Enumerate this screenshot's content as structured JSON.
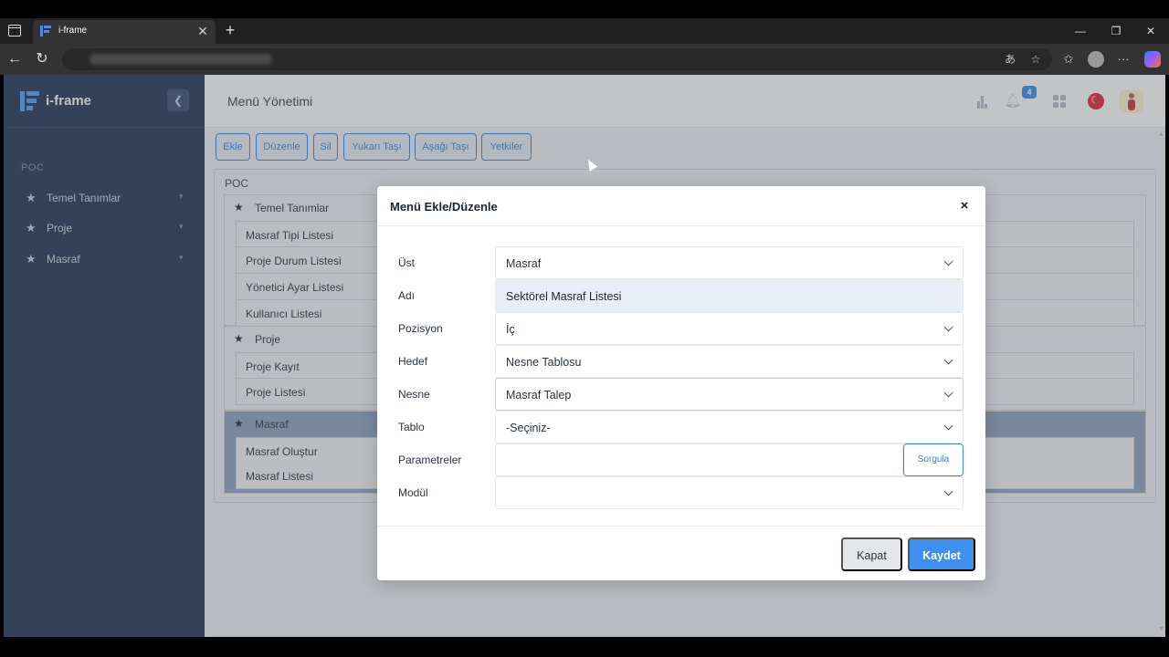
{
  "browser": {
    "tab_title": "i-frame",
    "new_tab": "+",
    "tab_close": "✕"
  },
  "sidebar": {
    "app_name": "i-frame",
    "section_label": "POC",
    "items": [
      {
        "label": "Temel Tanımlar"
      },
      {
        "label": "Proje"
      },
      {
        "label": "Masraf"
      }
    ]
  },
  "header": {
    "title": "Menü Yönetimi",
    "notification_count": "4"
  },
  "toolbar": {
    "buttons": [
      "Ekle",
      "Düzenle",
      "Sil",
      "Yukarı Taşı",
      "Aşağı Taşı",
      "Yetkiler"
    ]
  },
  "tree": {
    "root": "POC",
    "groups": [
      {
        "label": "Temel Tanımlar",
        "children": [
          "Masraf Tipi Listesi",
          "Proje Durum Listesi",
          "Yönetici Ayar Listesi",
          "Kullanıcı Listesi"
        ]
      },
      {
        "label": "Proje",
        "children": [
          "Proje Kayıt",
          "Proje Listesi"
        ]
      },
      {
        "label": "Masraf",
        "children": [
          "Masraf Oluştur",
          "Masraf Listesi"
        ]
      }
    ]
  },
  "modal": {
    "title": "Menü Ekle/Düzenle",
    "close_glyph": "×",
    "fields": [
      {
        "label": "Üst",
        "value": "Masraf"
      },
      {
        "label": "Adı",
        "value": "Sektörel Masraf Listesi"
      },
      {
        "label": "Pozisyon",
        "value": "İç"
      },
      {
        "label": "Hedef",
        "value": "Nesne Tablosu"
      },
      {
        "label": "Nesne",
        "value": "Masraf Talep"
      },
      {
        "label": "Tablo",
        "value": "-Seçiniz-"
      },
      {
        "label": "Parametreler",
        "value": ""
      },
      {
        "label": "Modül",
        "value": ""
      }
    ],
    "query_button": "Sorgula",
    "cancel_button": "Kapat",
    "save_button": "Kaydet"
  },
  "colors": {
    "sidebar_bg": "#253858",
    "accent": "#3d8ff0",
    "active_group": "#8fa3c0"
  }
}
